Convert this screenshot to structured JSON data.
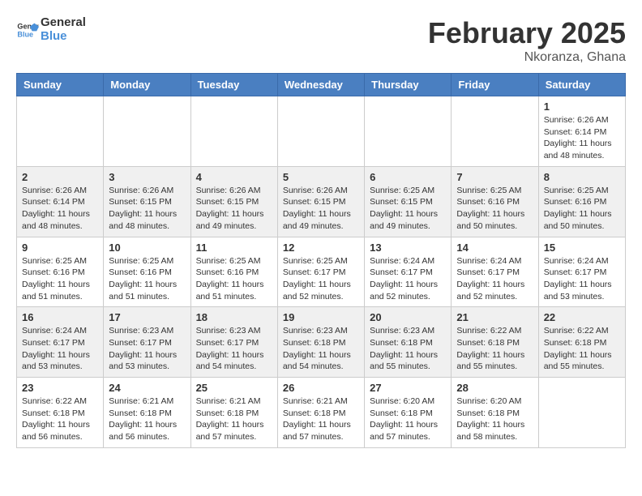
{
  "header": {
    "logo_general": "General",
    "logo_blue": "Blue",
    "month": "February 2025",
    "location": "Nkoranza, Ghana"
  },
  "weekdays": [
    "Sunday",
    "Monday",
    "Tuesday",
    "Wednesday",
    "Thursday",
    "Friday",
    "Saturday"
  ],
  "weeks": [
    [
      {
        "day": "",
        "info": ""
      },
      {
        "day": "",
        "info": ""
      },
      {
        "day": "",
        "info": ""
      },
      {
        "day": "",
        "info": ""
      },
      {
        "day": "",
        "info": ""
      },
      {
        "day": "",
        "info": ""
      },
      {
        "day": "1",
        "info": "Sunrise: 6:26 AM\nSunset: 6:14 PM\nDaylight: 11 hours and 48 minutes."
      }
    ],
    [
      {
        "day": "2",
        "info": "Sunrise: 6:26 AM\nSunset: 6:14 PM\nDaylight: 11 hours and 48 minutes."
      },
      {
        "day": "3",
        "info": "Sunrise: 6:26 AM\nSunset: 6:15 PM\nDaylight: 11 hours and 48 minutes."
      },
      {
        "day": "4",
        "info": "Sunrise: 6:26 AM\nSunset: 6:15 PM\nDaylight: 11 hours and 49 minutes."
      },
      {
        "day": "5",
        "info": "Sunrise: 6:26 AM\nSunset: 6:15 PM\nDaylight: 11 hours and 49 minutes."
      },
      {
        "day": "6",
        "info": "Sunrise: 6:25 AM\nSunset: 6:15 PM\nDaylight: 11 hours and 49 minutes."
      },
      {
        "day": "7",
        "info": "Sunrise: 6:25 AM\nSunset: 6:16 PM\nDaylight: 11 hours and 50 minutes."
      },
      {
        "day": "8",
        "info": "Sunrise: 6:25 AM\nSunset: 6:16 PM\nDaylight: 11 hours and 50 minutes."
      }
    ],
    [
      {
        "day": "9",
        "info": "Sunrise: 6:25 AM\nSunset: 6:16 PM\nDaylight: 11 hours and 51 minutes."
      },
      {
        "day": "10",
        "info": "Sunrise: 6:25 AM\nSunset: 6:16 PM\nDaylight: 11 hours and 51 minutes."
      },
      {
        "day": "11",
        "info": "Sunrise: 6:25 AM\nSunset: 6:16 PM\nDaylight: 11 hours and 51 minutes."
      },
      {
        "day": "12",
        "info": "Sunrise: 6:25 AM\nSunset: 6:17 PM\nDaylight: 11 hours and 52 minutes."
      },
      {
        "day": "13",
        "info": "Sunrise: 6:24 AM\nSunset: 6:17 PM\nDaylight: 11 hours and 52 minutes."
      },
      {
        "day": "14",
        "info": "Sunrise: 6:24 AM\nSunset: 6:17 PM\nDaylight: 11 hours and 52 minutes."
      },
      {
        "day": "15",
        "info": "Sunrise: 6:24 AM\nSunset: 6:17 PM\nDaylight: 11 hours and 53 minutes."
      }
    ],
    [
      {
        "day": "16",
        "info": "Sunrise: 6:24 AM\nSunset: 6:17 PM\nDaylight: 11 hours and 53 minutes."
      },
      {
        "day": "17",
        "info": "Sunrise: 6:23 AM\nSunset: 6:17 PM\nDaylight: 11 hours and 53 minutes."
      },
      {
        "day": "18",
        "info": "Sunrise: 6:23 AM\nSunset: 6:17 PM\nDaylight: 11 hours and 54 minutes."
      },
      {
        "day": "19",
        "info": "Sunrise: 6:23 AM\nSunset: 6:18 PM\nDaylight: 11 hours and 54 minutes."
      },
      {
        "day": "20",
        "info": "Sunrise: 6:23 AM\nSunset: 6:18 PM\nDaylight: 11 hours and 55 minutes."
      },
      {
        "day": "21",
        "info": "Sunrise: 6:22 AM\nSunset: 6:18 PM\nDaylight: 11 hours and 55 minutes."
      },
      {
        "day": "22",
        "info": "Sunrise: 6:22 AM\nSunset: 6:18 PM\nDaylight: 11 hours and 55 minutes."
      }
    ],
    [
      {
        "day": "23",
        "info": "Sunrise: 6:22 AM\nSunset: 6:18 PM\nDaylight: 11 hours and 56 minutes."
      },
      {
        "day": "24",
        "info": "Sunrise: 6:21 AM\nSunset: 6:18 PM\nDaylight: 11 hours and 56 minutes."
      },
      {
        "day": "25",
        "info": "Sunrise: 6:21 AM\nSunset: 6:18 PM\nDaylight: 11 hours and 57 minutes."
      },
      {
        "day": "26",
        "info": "Sunrise: 6:21 AM\nSunset: 6:18 PM\nDaylight: 11 hours and 57 minutes."
      },
      {
        "day": "27",
        "info": "Sunrise: 6:20 AM\nSunset: 6:18 PM\nDaylight: 11 hours and 57 minutes."
      },
      {
        "day": "28",
        "info": "Sunrise: 6:20 AM\nSunset: 6:18 PM\nDaylight: 11 hours and 58 minutes."
      },
      {
        "day": "",
        "info": ""
      }
    ]
  ]
}
